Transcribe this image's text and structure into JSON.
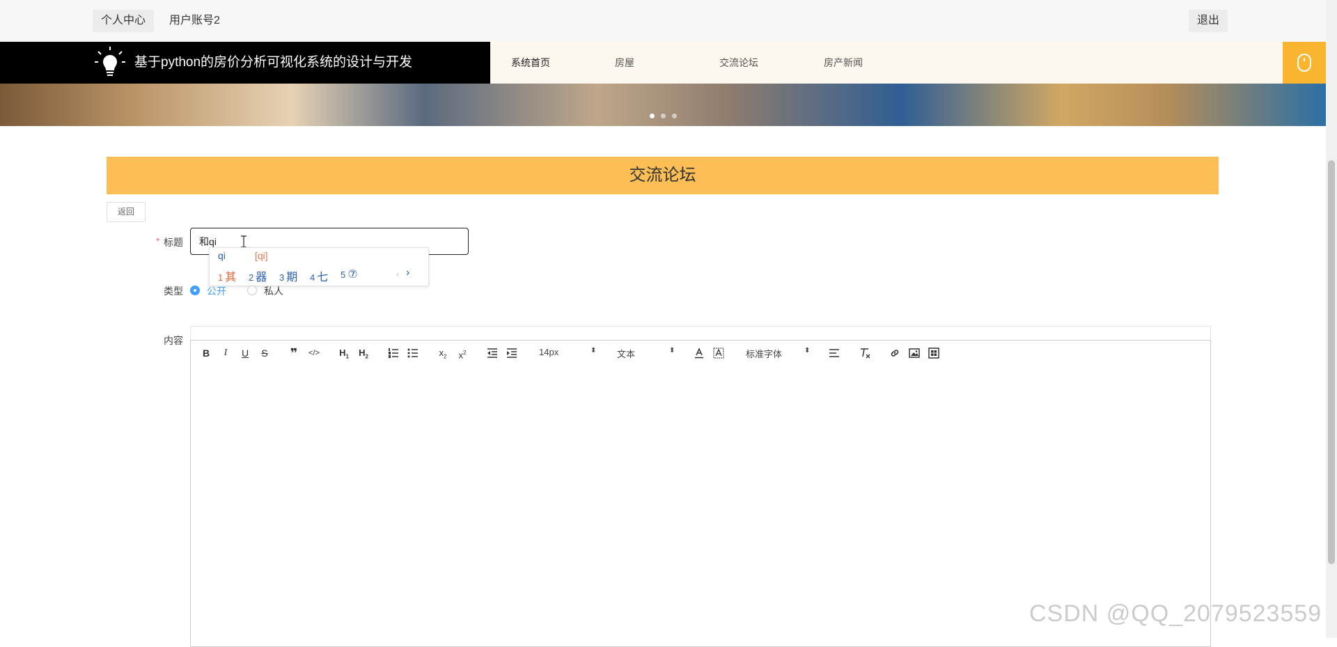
{
  "topbar": {
    "personal_center": "个人中心",
    "account": "用户账号2",
    "logout": "退出"
  },
  "header": {
    "site_title": "基于python的房价分析可视化系统的设计与开发",
    "nav": [
      "系统首页",
      "房屋",
      "交流论坛",
      "房产新闻"
    ]
  },
  "page": {
    "section_title": "交流论坛",
    "back": "返回"
  },
  "form": {
    "title_label": "标题",
    "required_mark": "*",
    "title_value": "和qi",
    "type_label": "类型",
    "type_options": [
      "公开",
      "私人"
    ],
    "content_label": "内容"
  },
  "ime": {
    "composition": "qi",
    "pinyin": "[qi]",
    "candidates": [
      {
        "num": "1",
        "text": "其"
      },
      {
        "num": "2",
        "text": "器"
      },
      {
        "num": "3",
        "text": "期"
      },
      {
        "num": "4",
        "text": "七"
      },
      {
        "num": "5",
        "text": "⑦"
      }
    ],
    "prev": "‹",
    "next": "›"
  },
  "editor": {
    "size": "14px",
    "header": "文本",
    "font": "标准字体"
  },
  "watermark": "CSDN @QQ_2079523559",
  "colors": {
    "accent": "#fdbf55",
    "brand_bg": "#000000",
    "nav_bg": "#fdf8ee",
    "radio_blue": "#409eff"
  }
}
